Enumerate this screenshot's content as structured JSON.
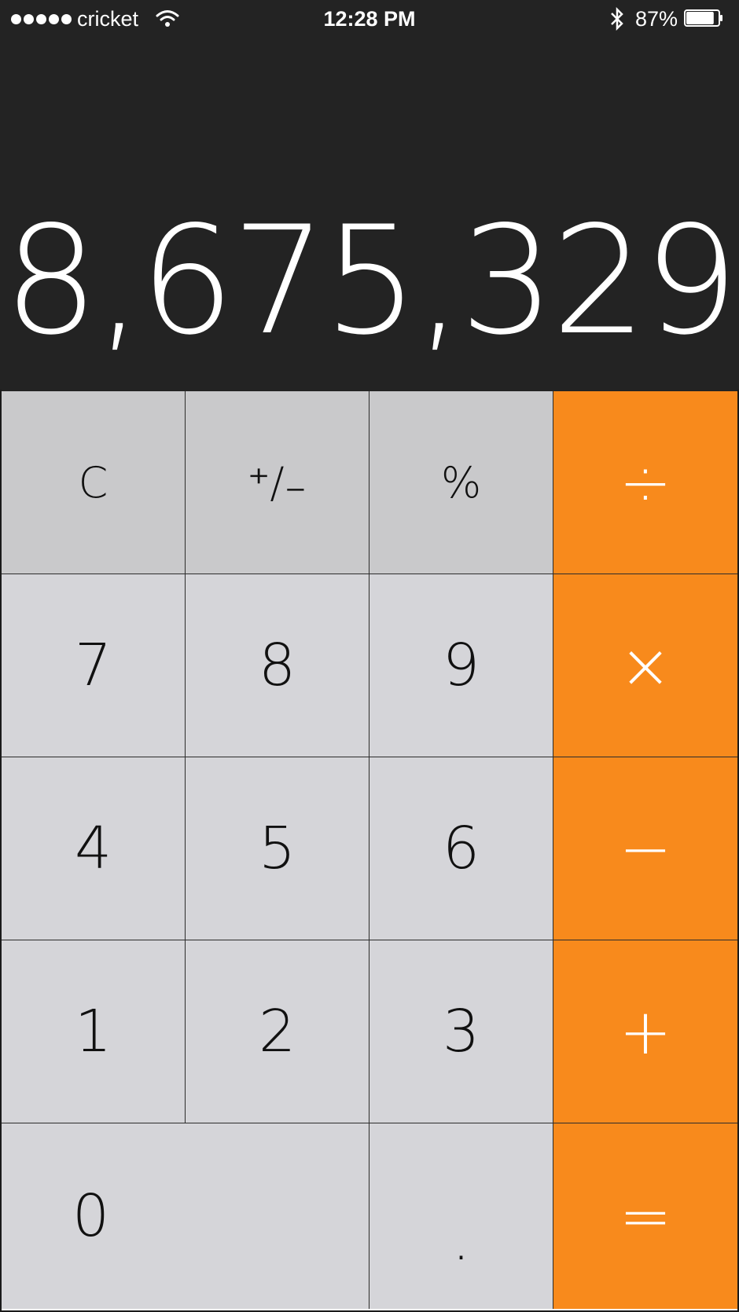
{
  "status_bar": {
    "carrier": "cricket",
    "time": "12:28 PM",
    "battery_percent": "87%",
    "battery_level": 0.87,
    "signal_bars": 5,
    "icons": [
      "signal-dots-icon",
      "wifi-icon",
      "bluetooth-icon",
      "battery-icon"
    ]
  },
  "display": {
    "value": "8,675,329"
  },
  "keys": {
    "clear": "C",
    "plus_minus": "⁺∕₋",
    "percent": "%",
    "divide": "÷",
    "seven": "7",
    "eight": "8",
    "nine": "9",
    "multiply": "×",
    "four": "4",
    "five": "5",
    "six": "6",
    "minus": "−",
    "one": "1",
    "two": "2",
    "three": "3",
    "plus": "+",
    "zero": "0",
    "decimal": ".",
    "equals": "="
  },
  "colors": {
    "display_background": "#232323",
    "function_keys": "#c9c9cb",
    "number_keys": "#d5d5d9",
    "operator_keys": "#f88a1c",
    "operator_text": "#ffffff",
    "key_text": "#111111"
  }
}
